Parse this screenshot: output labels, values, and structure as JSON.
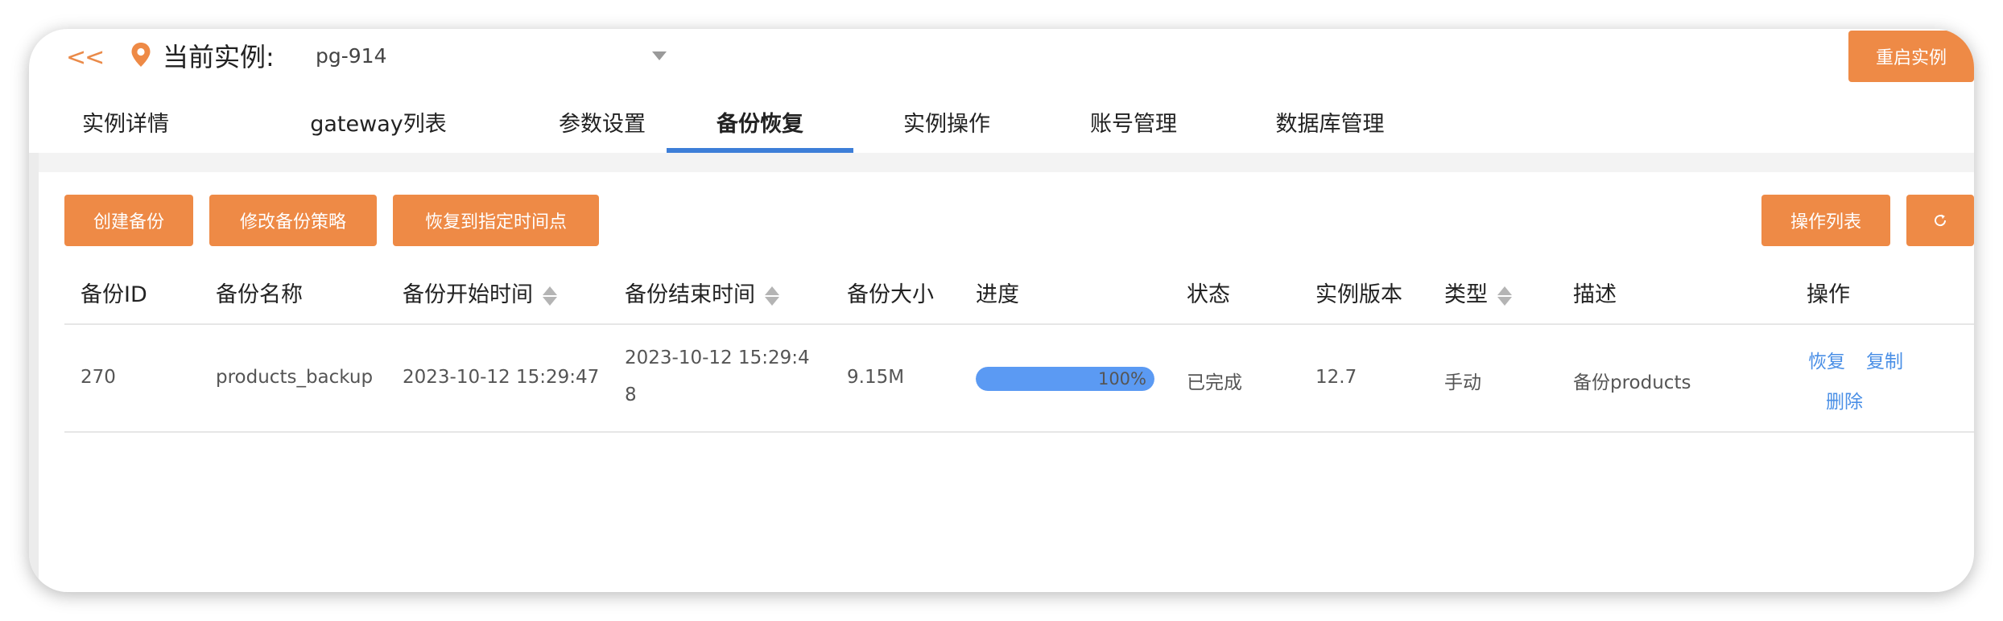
{
  "header": {
    "back_label": "<<",
    "instance_label": "当前实例:",
    "instance_value": "pg-914",
    "restart_label": "重启实例"
  },
  "tabs": [
    {
      "label": "实例详情"
    },
    {
      "label": "gateway列表"
    },
    {
      "label": "参数设置"
    },
    {
      "label": "备份恢复",
      "active": true
    },
    {
      "label": "实例操作"
    },
    {
      "label": "账号管理"
    },
    {
      "label": "数据库管理"
    }
  ],
  "toolbar": {
    "create_backup": "创建备份",
    "modify_policy": "修改备份策略",
    "restore_to_time": "恢复到指定时间点",
    "operation_list": "操作列表",
    "refresh_icon": "refresh-icon"
  },
  "table": {
    "columns": [
      "备份ID",
      "备份名称",
      "备份开始时间",
      "备份结束时间",
      "备份大小",
      "进度",
      "状态",
      "实例版本",
      "类型",
      "描述",
      "操作"
    ],
    "rows": [
      {
        "id": "270",
        "name": "products_backup",
        "start": "2023-10-12 15:29:47",
        "end": "2023-10-12 15:29:48",
        "size": "9.15M",
        "progress": 100,
        "progress_label": "100%",
        "status": "已完成",
        "version": "12.7",
        "type": "手动",
        "desc": "备份products",
        "actions": {
          "restore": "恢复",
          "copy": "复制",
          "delete": "删除"
        }
      }
    ]
  },
  "colors": {
    "accent": "#ee8a46",
    "tab_active": "#3d7ed8",
    "link": "#4a8fe6",
    "progress": "#5b9af3"
  }
}
